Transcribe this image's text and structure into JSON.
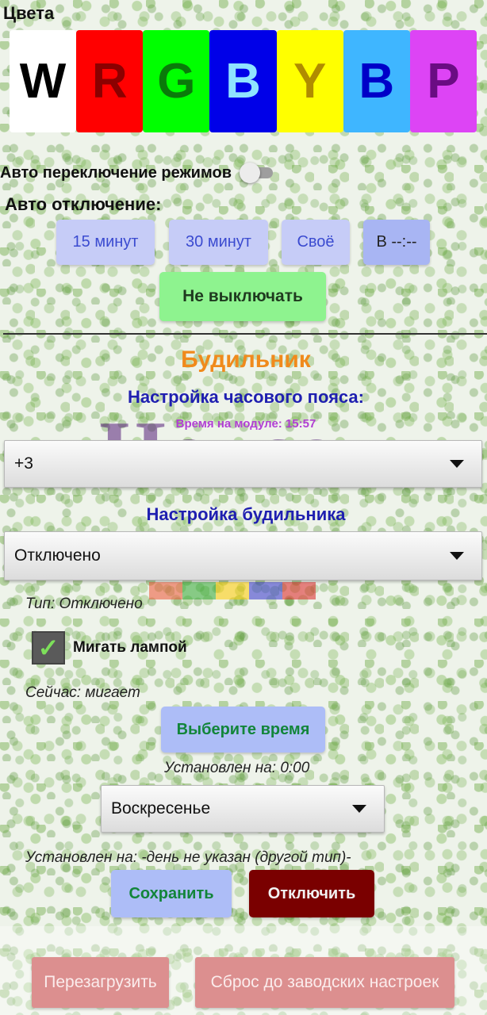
{
  "colors_section": {
    "title": "Цвета",
    "buttons": [
      {
        "letter": "W",
        "bg": "#ffffff",
        "fg": "#000000"
      },
      {
        "letter": "R",
        "bg": "#ff0000",
        "fg": "#8b0000"
      },
      {
        "letter": "G",
        "bg": "#00ff00",
        "fg": "#0a7a0a"
      },
      {
        "letter": "B",
        "bg": "#0000e8",
        "fg": "#8fe3ff"
      },
      {
        "letter": "Y",
        "bg": "#ffff00",
        "fg": "#b08c00"
      },
      {
        "letter": "B",
        "bg": "#3fb6ff",
        "fg": "#0000c8"
      },
      {
        "letter": "P",
        "bg": "#dd44f5",
        "fg": "#6a0c83"
      }
    ]
  },
  "auto_switch": {
    "label": "Авто переключение режимов",
    "on": false
  },
  "auto_off": {
    "label": "Авто отключение:",
    "btn_15": "15 минут",
    "btn_30": "30 минут",
    "btn_custom": "Своё",
    "btn_at": "В --:--",
    "btn_never": "Не выключать"
  },
  "alarm": {
    "title": "Будильник",
    "timezone_title": "Настройка часового пояса:",
    "module_time": "Время на модуле:   15:57",
    "timezone_value": "+3",
    "config_title": "Настройка будильника",
    "mode_value": "Отключено",
    "type_text": "Тип: Отключено",
    "blink_label": "Мигать лампой",
    "blink_checked": true,
    "now_text": "Сейчас: мигает",
    "select_time_btn": "Выберите время",
    "set_time_text": "Установлен на:  0:00",
    "day_value": "Воскресенье",
    "set_day_text": "Установлен на:  -день не указан (другой тип)-",
    "save_btn": "Сохранить",
    "disable_btn": "Отключить"
  },
  "footer": {
    "reboot_btn": "Перезагрузить",
    "reset_btn": "Сброс до заводских настроек"
  },
  "watermark": {
    "text": "House"
  }
}
